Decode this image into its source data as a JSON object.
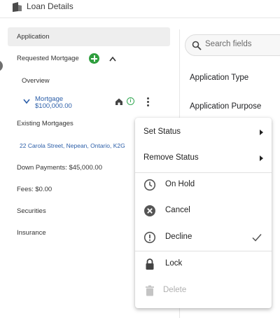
{
  "header": {
    "title": "Loan Details",
    "logo_icon": "loan-logo-icon"
  },
  "sidebar": {
    "application": "Application",
    "requested_mortgage": "Requested Mortgage",
    "overview": "Overview",
    "mortgage_title": "Mortgage",
    "mortgage_amount": "$100,000.00",
    "existing_mortgages": "Existing Mortgages",
    "address": "22 Carola Street, Nepean, Ontario, K2G",
    "down_payments": "Down Payments: $45,000.00",
    "fees": "Fees: $0.00",
    "securities": "Securities",
    "insurance": "Insurance"
  },
  "main": {
    "search_placeholder": "Search fields",
    "fields": [
      "Application Type",
      "Application Purpose"
    ]
  },
  "context_menu": {
    "set_status": "Set Status",
    "remove_status": "Remove Status",
    "on_hold": "On Hold",
    "cancel": "Cancel",
    "decline": "Decline",
    "lock": "Lock",
    "delete": "Delete"
  },
  "colors": {
    "accent_green": "#2f9e3e",
    "link_blue": "#2b5ea8"
  }
}
